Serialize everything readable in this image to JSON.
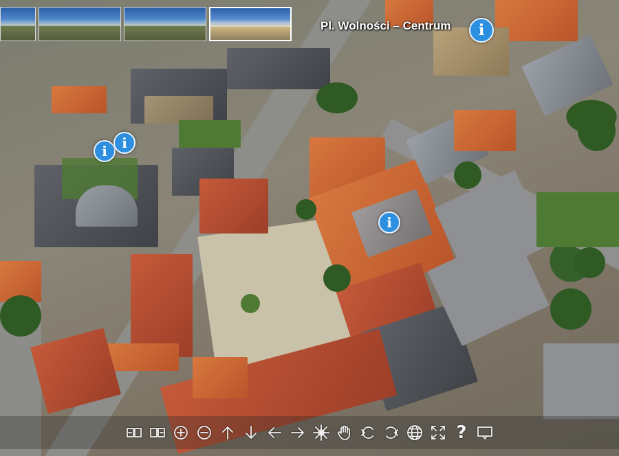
{
  "title": "Pl. Wolności – Centrum",
  "thumbnails": [
    {
      "label": "",
      "active": false
    },
    {
      "label": "",
      "active": false
    },
    {
      "label": "",
      "active": false
    },
    {
      "label": "",
      "active": true
    }
  ],
  "hotspots": [
    {
      "icon": "info-icon",
      "glyph": "i"
    },
    {
      "icon": "info-icon",
      "glyph": "i"
    },
    {
      "icon": "info-icon",
      "glyph": "i"
    },
    {
      "icon": "info-icon",
      "glyph": "i"
    }
  ],
  "toolbar": {
    "buttons": [
      {
        "name": "previous-panorama-icon"
      },
      {
        "name": "next-panorama-icon"
      },
      {
        "name": "zoom-in-icon"
      },
      {
        "name": "zoom-out-icon"
      },
      {
        "name": "pan-up-icon"
      },
      {
        "name": "pan-down-icon"
      },
      {
        "name": "pan-left-icon"
      },
      {
        "name": "pan-right-icon"
      },
      {
        "name": "autorotate-icon"
      },
      {
        "name": "drag-hand-icon"
      },
      {
        "name": "rotate-left-icon"
      },
      {
        "name": "rotate-right-icon"
      },
      {
        "name": "globe-icon"
      },
      {
        "name": "fullscreen-icon"
      },
      {
        "name": "help-icon",
        "glyph": "?"
      },
      {
        "name": "info-screen-icon"
      }
    ]
  },
  "colors": {
    "hotspot": "#2d8fe0",
    "toolbar_icon": "#f2f2f2"
  }
}
